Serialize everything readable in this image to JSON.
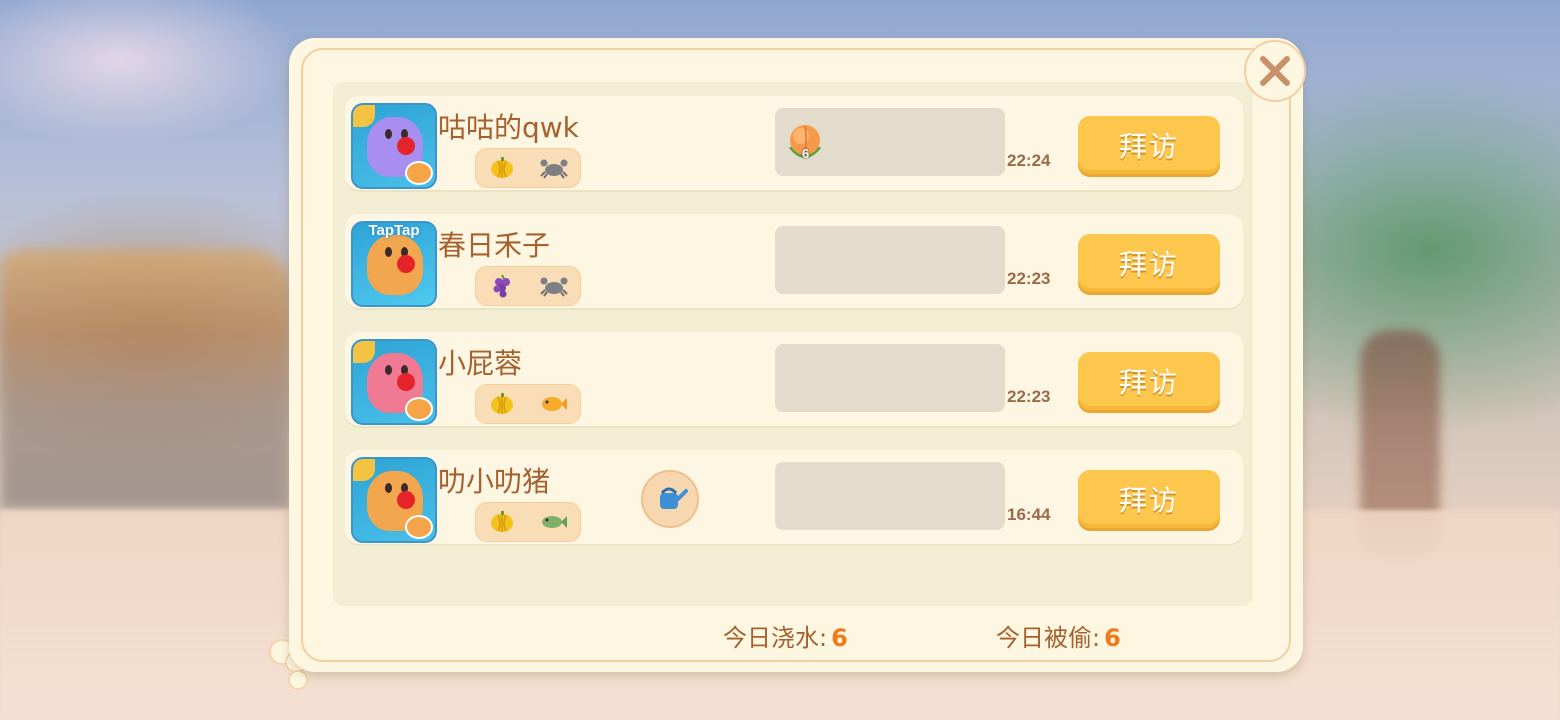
{
  "friends": [
    {
      "name": "咕咕的qwk",
      "avatar_color": "#a98ef2",
      "taptap": "",
      "tags": [
        "pumpkin-icon",
        "crab-icon"
      ],
      "gift": "peach-icon",
      "gift_count": "6",
      "time": "22:24",
      "visit_label": "拜访"
    },
    {
      "name": "春日禾子",
      "avatar_color": "#f2a64e",
      "taptap": "TapTap",
      "tags": [
        "grape-icon",
        "crab-icon"
      ],
      "gift": "",
      "gift_count": "",
      "time": "22:23",
      "visit_label": "拜访"
    },
    {
      "name": "小屁蓉",
      "avatar_color": "#f07a93",
      "taptap": "",
      "tags": [
        "pumpkin-icon",
        "goldfish-icon"
      ],
      "gift": "",
      "gift_count": "",
      "time": "22:23",
      "visit_label": "拜访"
    },
    {
      "name": "叻小叻猪",
      "avatar_color": "#f2a64e",
      "taptap": "",
      "tags": [
        "pumpkin-icon",
        "green-fish-icon"
      ],
      "gift": "",
      "gift_count": "",
      "time": "16:44",
      "visit_label": "拜访",
      "watering": "watering-can-icon"
    }
  ],
  "footer": {
    "water_label": "今日浇水:",
    "water_value": "6",
    "stolen_label": "今日被偷:",
    "stolen_value": "6"
  },
  "colors": {
    "accent": "#fdc64d",
    "name_text": "#a5622f",
    "value_text": "#f07a18"
  }
}
